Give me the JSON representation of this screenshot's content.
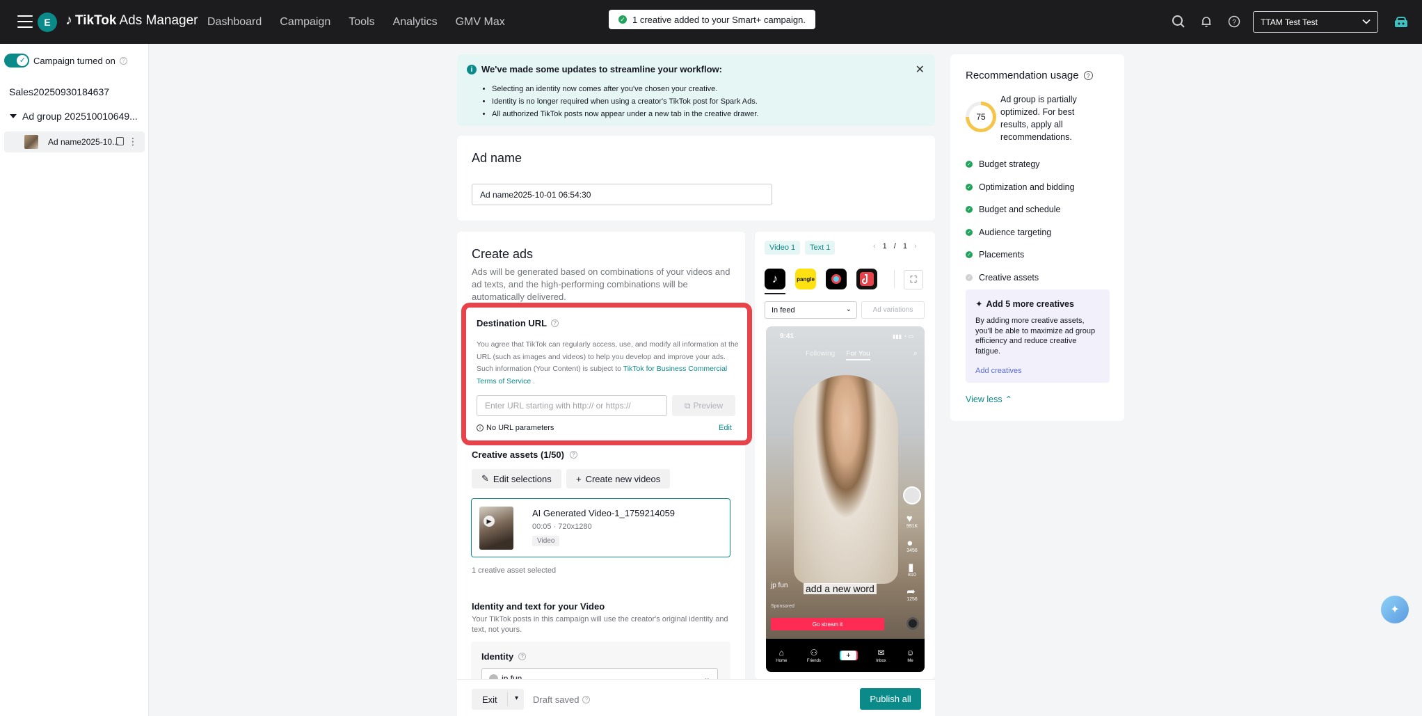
{
  "app": {
    "brand_name": "TikTok",
    "brand_suffix": "Ads Manager",
    "avatar_letter": "E"
  },
  "nav": [
    "Dashboard",
    "Campaign",
    "Tools",
    "Analytics",
    "GMV Max"
  ],
  "toast": "1 creative added to your Smart+ campaign.",
  "account": "TTAM Test Test",
  "sidebar": {
    "toggle_label": "Campaign turned on",
    "campaign_name": "Sales20250930184637",
    "ad_group": "Ad group 202510010649...",
    "ad_name": "Ad name2025-10..."
  },
  "notice": {
    "title": "We've made some updates to streamline your workflow:",
    "items": [
      "Selecting an identity now comes after you've chosen your creative.",
      "Identity is no longer required when using a creator's TikTok post for Spark Ads.",
      "All authorized TikTok posts now appear under a new tab in the creative drawer."
    ]
  },
  "ad_name_section": {
    "title": "Ad name",
    "value": "Ad name2025-10-01 06:54:30"
  },
  "create_ads": {
    "title": "Create ads",
    "desc": "Ads will be generated based on combinations of your videos and ad texts, and the high-performing combinations will be automatically delivered."
  },
  "destination": {
    "title": "Destination URL",
    "text": "You agree that TikTok can regularly access, use, and modify all information at the URL (such as images and videos) to help you develop and improve your ads. Such information (Your Content) is subject to ",
    "link": "TikTok for Business Commercial Terms of Service",
    "text_end": " .",
    "placeholder": "Enter URL starting with http:// or https://",
    "preview": "Preview",
    "params": "No URL parameters",
    "edit": "Edit"
  },
  "assets": {
    "title": "Creative assets (1/50)",
    "edit_btn": "Edit selections",
    "create_btn": "Create new videos",
    "video_name": "AI Generated Video-1_1759214059",
    "video_meta": "00:05 · 720x1280",
    "video_tag": "Video",
    "count": "1 creative asset selected"
  },
  "identity": {
    "title": "Identity and text for your Video",
    "desc": "Your TikTok posts in this campaign will use the creator's original identity and text, not yours.",
    "label": "Identity",
    "value": "jp fun"
  },
  "bottom": {
    "exit": "Exit",
    "draft": "Draft saved",
    "publish": "Publish all"
  },
  "preview": {
    "chip_video": "Video 1",
    "chip_text": "Text 1",
    "page_current": "1",
    "page_sep": "/",
    "page_total": "1",
    "placement": "In feed",
    "ad_variations": "Ad variations",
    "pangle_label": "pangle",
    "phone": {
      "time": "9:41",
      "tab_following": "Following",
      "tab_foryou": "For You",
      "likes": "991K",
      "comments": "3456",
      "saves": "810",
      "shares": "1256",
      "handle": "jp fun",
      "caption": "add a new word",
      "sponsored": "Sponsored",
      "cta": "Go stream it",
      "nav": [
        "Home",
        "Friends",
        "",
        "Inbox",
        "Me"
      ]
    }
  },
  "recommendation": {
    "title": "Recommendation usage",
    "score": "75",
    "desc": "Ad group is partially optimized. For best results, apply all recommendations.",
    "items": [
      {
        "label": "Budget strategy",
        "done": true
      },
      {
        "label": "Optimization and bidding",
        "done": true
      },
      {
        "label": "Budget and schedule",
        "done": true
      },
      {
        "label": "Audience targeting",
        "done": true
      },
      {
        "label": "Placements",
        "done": true
      },
      {
        "label": "Creative assets",
        "done": false
      }
    ],
    "tip_title": "Add 5 more creatives",
    "tip_desc": "By adding more creative assets, you'll be able to maximize ad group efficiency and reduce creative fatigue.",
    "tip_link": "Add creatives",
    "view_less": "View less"
  }
}
